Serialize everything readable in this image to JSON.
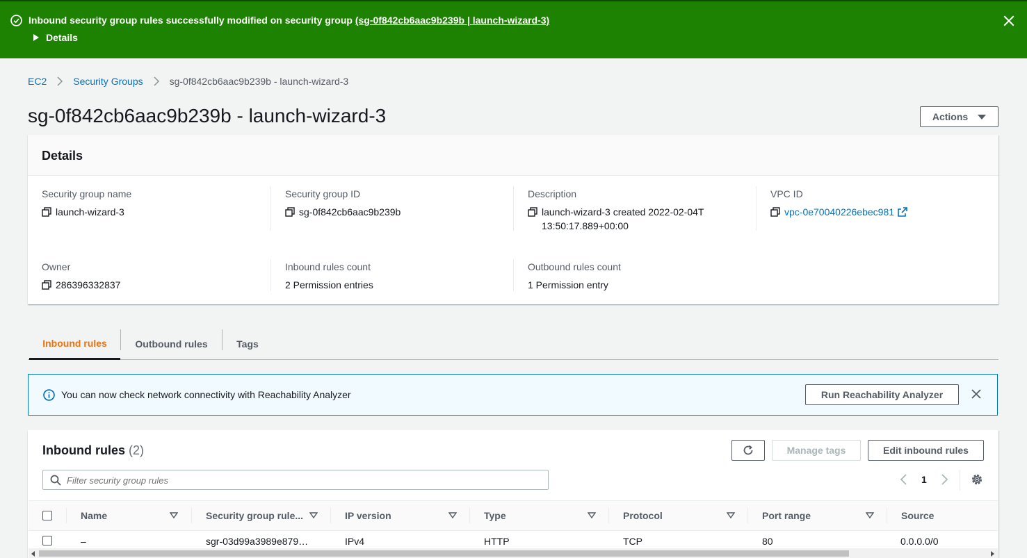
{
  "flash": {
    "message": "Inbound security group rules successfully modified on security group ",
    "link": "(sg-0f842cb6aac9b239b | launch-wizard-3)",
    "details_label": "Details",
    "color": "#1d8102"
  },
  "breadcrumb": {
    "items": [
      "EC2",
      "Security Groups"
    ],
    "current": "sg-0f842cb6aac9b239b - launch-wizard-3"
  },
  "page": {
    "title": "sg-0f842cb6aac9b239b - launch-wizard-3",
    "actions_label": "Actions"
  },
  "details": {
    "header": "Details",
    "fields": [
      {
        "label": "Security group name",
        "value": "launch-wizard-3"
      },
      {
        "label": "Security group ID",
        "value": "sg-0f842cb6aac9b239b"
      },
      {
        "label": "Description",
        "value": "launch-wizard-3 created 2022-02-04T13:50:17.889+00:00"
      },
      {
        "label": "VPC ID",
        "value": "vpc-0e70040226ebec981"
      },
      {
        "label": "Owner",
        "value": "286396332837"
      },
      {
        "label": "Inbound rules count",
        "value": "2 Permission entries"
      },
      {
        "label": "Outbound rules count",
        "value": "1 Permission entry"
      }
    ]
  },
  "tabs": [
    "Inbound rules",
    "Outbound rules",
    "Tags"
  ],
  "active_tab": "Inbound rules",
  "info_banner": {
    "text": "You can now check network connectivity with Reachability Analyzer",
    "button": "Run Reachability Analyzer"
  },
  "rules": {
    "title": "Inbound rules",
    "count": "(2)",
    "manage_tags": "Manage tags",
    "edit_rules": "Edit inbound rules",
    "filter_placeholder": "Filter security group rules",
    "page": "1",
    "columns": [
      "Name",
      "Security group rule...",
      "IP version",
      "Type",
      "Protocol",
      "Port range",
      "Source"
    ],
    "rows": [
      [
        "–",
        "sgr-03d99a3989e879…",
        "IPv4",
        "HTTP",
        "TCP",
        "80",
        "0.0.0.0/0"
      ]
    ]
  },
  "colors": {
    "link": "#0073bb",
    "active_tab": "#ec7211",
    "info_bg": "#f1faff"
  }
}
